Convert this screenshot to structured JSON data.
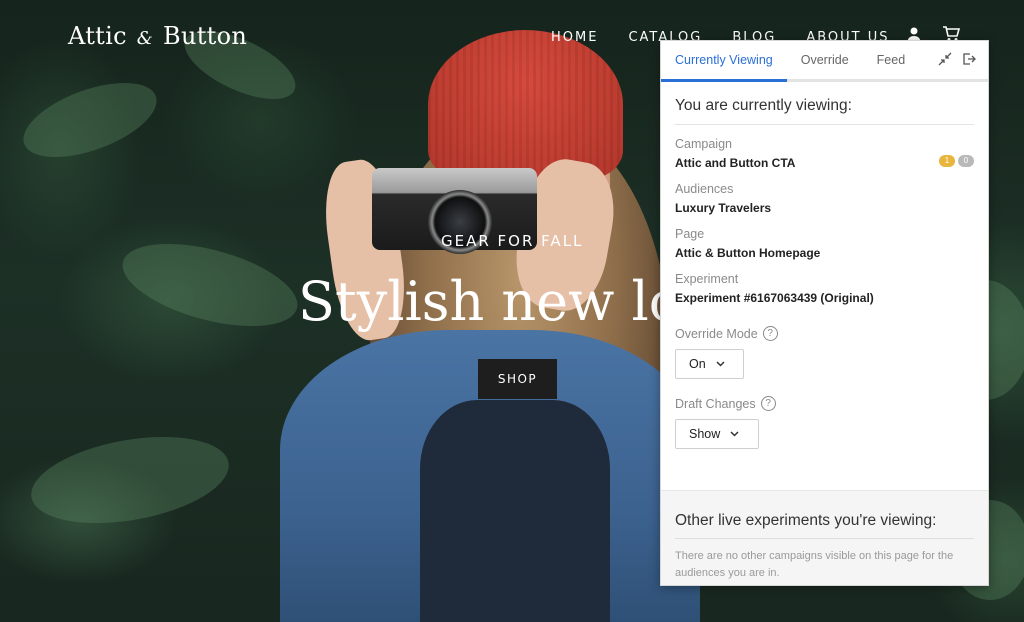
{
  "site": {
    "logo": {
      "part1": "Attic",
      "amp": "&",
      "part2": "Button"
    },
    "nav": [
      "HOME",
      "CATALOG",
      "BLOG",
      "ABOUT US"
    ],
    "icons": {
      "user": "user-icon",
      "cart": "cart-icon"
    },
    "hero": {
      "kicker": "GEAR FOR FALL",
      "title": "Stylish new lo",
      "cta": "SHOP"
    }
  },
  "panel": {
    "tabs": [
      "Currently Viewing",
      "Override",
      "Feed"
    ],
    "active_tab": "Currently Viewing",
    "tab_icons": [
      "collapse-icon",
      "exit-icon"
    ],
    "heading": "You are currently viewing:",
    "campaign": {
      "label": "Campaign",
      "value": "Attic and Button CTA",
      "badge_a": "1",
      "badge_b": "0"
    },
    "audiences": {
      "label": "Audiences",
      "value": "Luxury Travelers"
    },
    "page": {
      "label": "Page",
      "value": "Attic & Button Homepage"
    },
    "experiment": {
      "label": "Experiment",
      "value": "Experiment #6167063439 (Original)"
    },
    "override_mode": {
      "label": "Override Mode",
      "help": "?",
      "value": "On"
    },
    "draft_changes": {
      "label": "Draft Changes",
      "help": "?",
      "value": "Show"
    },
    "other": {
      "heading": "Other live experiments you're viewing:",
      "text": "There are no other campaigns visible on this page for the audiences you are in."
    },
    "colors": {
      "accent": "#2a6fd6",
      "badge_yellow": "#e8b53d",
      "badge_gray": "#b9b9b9"
    }
  }
}
